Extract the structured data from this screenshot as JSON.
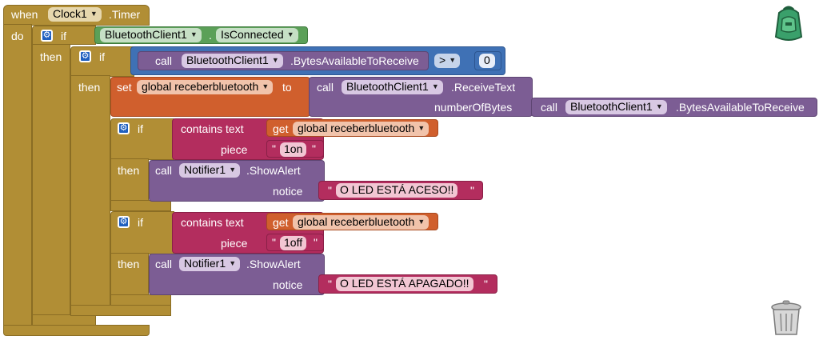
{
  "event": {
    "when": "when",
    "component": "Clock1",
    "event": ".Timer",
    "do": "do"
  },
  "if1": {
    "if": "if",
    "then": "then",
    "component": "BluetoothClient1",
    "property": "IsConnected"
  },
  "if2": {
    "if": "if",
    "then": "then",
    "call": "call",
    "component": "BluetoothClient1",
    "method": ".BytesAvailableToReceive",
    "operator": ">",
    "value": "0"
  },
  "set": {
    "set": "set",
    "variable": "global receberbluetooth",
    "to": "to",
    "call": "call",
    "component": "BluetoothClient1",
    "method": ".ReceiveText",
    "param": "numberOfBytes",
    "call2": "call",
    "component2": "BluetoothClient1",
    "method2": ".BytesAvailableToReceive"
  },
  "if3": {
    "if": "if",
    "then": "then",
    "contains": "contains text",
    "get": "get",
    "variable": "global receberbluetooth",
    "piece": "piece",
    "piece_value": "1on",
    "call": "call",
    "component": "Notifier1",
    "method": ".ShowAlert",
    "notice": "notice",
    "message": "O LED ESTÁ ACESO!!"
  },
  "if4": {
    "if": "if",
    "then": "then",
    "contains": "contains text",
    "get": "get",
    "variable": "global receberbluetooth",
    "piece": "piece",
    "piece_value": "1off",
    "call": "call",
    "component": "Notifier1",
    "method": ".ShowAlert",
    "notice": "notice",
    "message": "O LED ESTÁ APAGADO!!"
  },
  "quote": "\"",
  "icons": {
    "backpack": "backpack-icon",
    "trash": "trash-icon",
    "gear": "gear-icon",
    "dropdown": "chevron-down-icon"
  },
  "colors": {
    "control": "#b18e35",
    "logic": "#5ba058",
    "math": "#3f71b5",
    "component": "#7c5d94",
    "variable": "#d05f2d",
    "text": "#b32d5e"
  }
}
